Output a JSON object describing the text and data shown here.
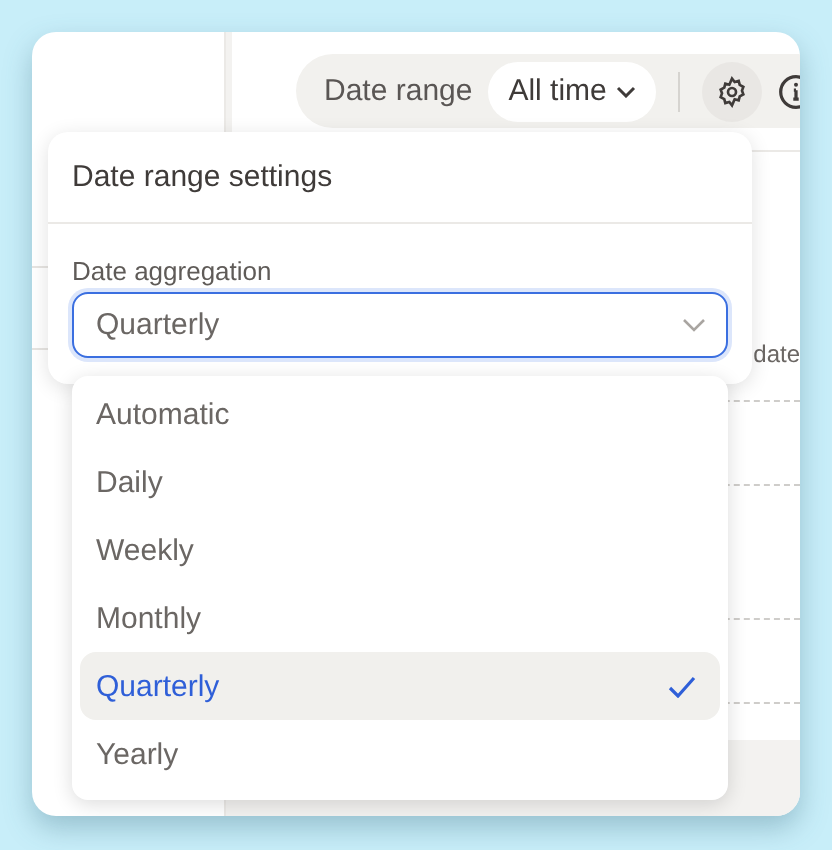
{
  "toolbar": {
    "label": "Date range",
    "range_button": "All time"
  },
  "background": {
    "axis_label": "date"
  },
  "popover": {
    "title": "Date range settings",
    "field_label": "Date aggregation",
    "select_value": "Quarterly",
    "options": [
      {
        "label": "Automatic",
        "selected": false
      },
      {
        "label": "Daily",
        "selected": false
      },
      {
        "label": "Weekly",
        "selected": false
      },
      {
        "label": "Monthly",
        "selected": false
      },
      {
        "label": "Quarterly",
        "selected": true
      },
      {
        "label": "Yearly",
        "selected": false
      }
    ]
  }
}
